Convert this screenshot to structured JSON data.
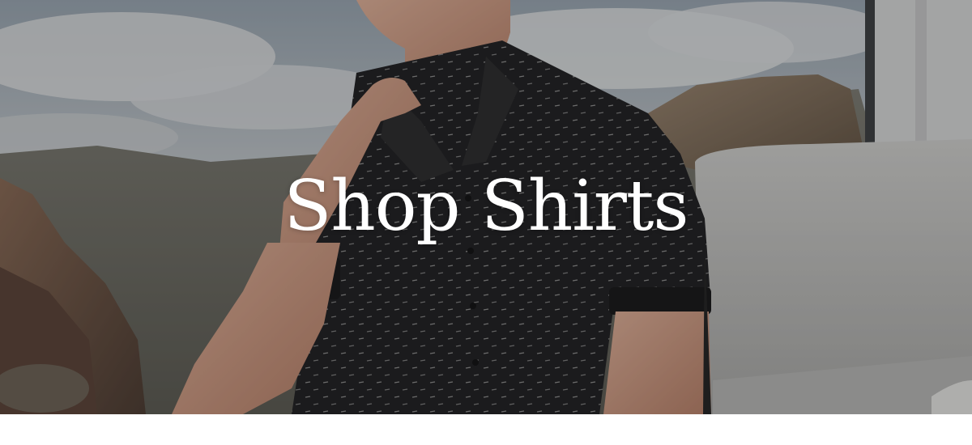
{
  "banner": {
    "headline": "Shop Shirts"
  },
  "colors": {
    "overlay": "#141416",
    "shirt": "#1e1e20",
    "headline_text": "#ffffff",
    "background": "#ffffff"
  }
}
